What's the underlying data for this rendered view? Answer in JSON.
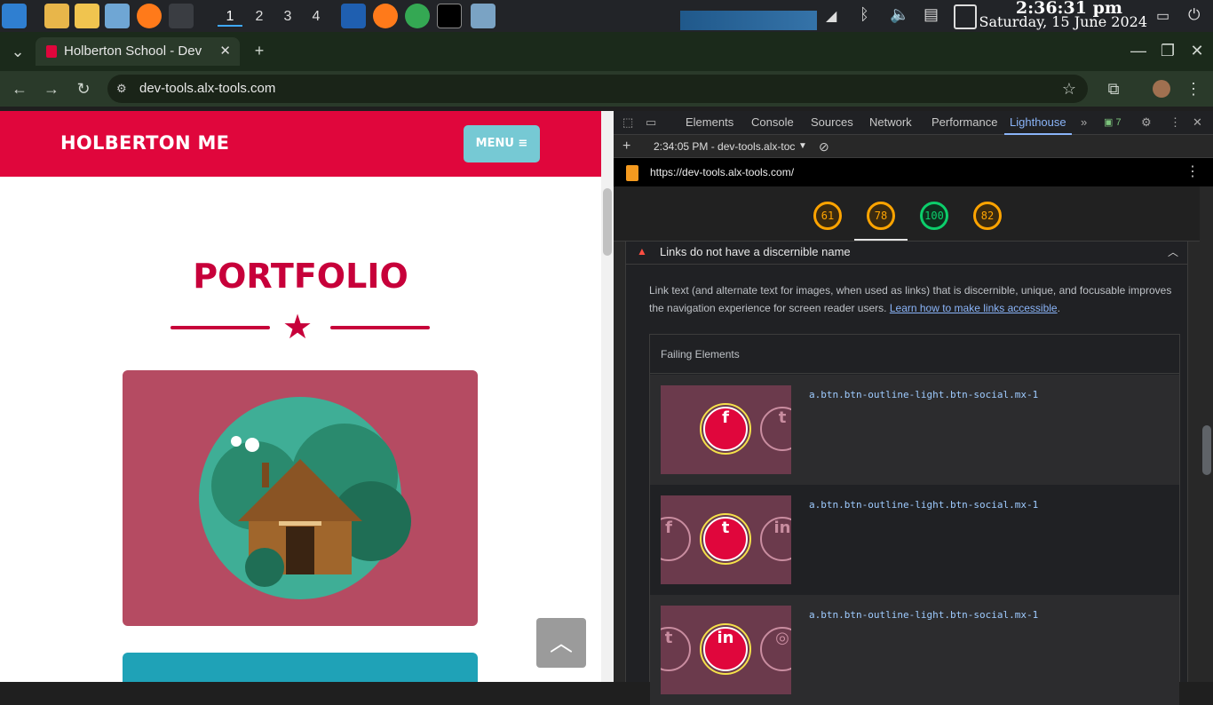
{
  "taskbar": {
    "workspaces": [
      "1",
      "2",
      "3",
      "4"
    ],
    "time": "2:36:31 pm",
    "date": "Saturday, 15 June 2024"
  },
  "browser": {
    "tab_title": "Holberton School - Dev",
    "url": "dev-tools.alx-tools.com"
  },
  "page": {
    "brand": "HOLBERTON ME",
    "menu_label": "MENU ≡",
    "section_title": "PORTFOLIO",
    "scroll_top_icon": "chevron-up-icon"
  },
  "devtools": {
    "tabs": [
      "Elements",
      "Console",
      "Sources",
      "Network",
      "Performance",
      "Lighthouse"
    ],
    "active_tab": "Lighthouse",
    "issues_count": "7",
    "report_time": "2:34:05 PM - dev-tools.alx-toc",
    "report_url": "https://dev-tools.alx-tools.com/",
    "scores": [
      "61",
      "78",
      "100",
      "82"
    ],
    "audit": {
      "title": "Links do not have a discernible name",
      "description": "Link text (and alternate text for images, when used as links) that is discernible, unique, and focusable improves the navigation experience for screen reader users.",
      "link_text": "Learn how to make links accessible",
      "failing_header": "Failing Elements",
      "failing_elements": [
        "a.btn.btn-outline-light.btn-social.mx-1",
        "a.btn.btn-outline-light.btn-social.mx-1",
        "a.btn.btn-outline-light.btn-social.mx-1"
      ]
    }
  },
  "colors": {
    "brand_red": "#e0063c",
    "menu_teal": "#76c9d4",
    "score_orange": "#ffa400",
    "score_green": "#0cce6b"
  }
}
